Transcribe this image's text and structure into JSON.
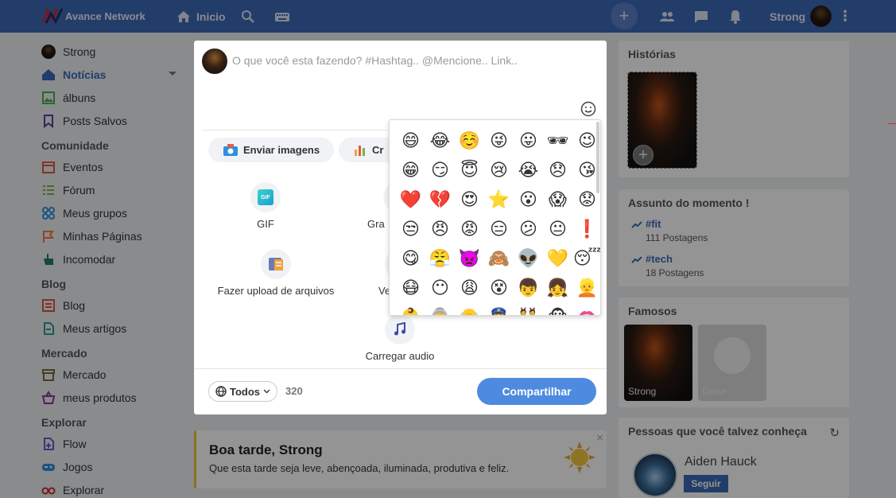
{
  "topbar": {
    "brand": "Avance Network",
    "home_label": "Inicio",
    "user_name": "Strong"
  },
  "sidebar": {
    "items": [
      {
        "label": "Strong"
      },
      {
        "label": "Notícias"
      },
      {
        "label": "álbuns"
      },
      {
        "label": "Posts Salvos"
      }
    ],
    "sections": [
      {
        "title": "Comunidade",
        "items": [
          "Eventos",
          "Fórum",
          "Meus grupos",
          "Minhas Páginas",
          "Incomodar"
        ]
      },
      {
        "title": "Blog",
        "items": [
          "Blog",
          "Meus artigos"
        ]
      },
      {
        "title": "Mercado",
        "items": [
          "Mercado",
          "meus produtos"
        ]
      },
      {
        "title": "Explorar",
        "items": [
          "Flow",
          "Jogos",
          "Explorar"
        ]
      }
    ]
  },
  "greeting": {
    "title": "Boa tarde, Strong",
    "subtitle": "Que esta tarde seja leve, abençoada, iluminada, produtiva e feliz.",
    "close": "×"
  },
  "right": {
    "stories_title": "Histórias",
    "trending_title": "Assunto do momento !",
    "trends": [
      {
        "tag": "#fit",
        "count": "111 Postagens"
      },
      {
        "tag": "#tech",
        "count": "18 Postagens"
      }
    ],
    "famous_title": "Famosos",
    "famous": [
      {
        "name": "Strong"
      },
      {
        "name": "Deise"
      }
    ],
    "people_title": "Pessoas que você talvez conheça",
    "person_name": "Aiden Hauck",
    "follow_label": "Seguir"
  },
  "composer": {
    "placeholder": "O que você esta fazendo? #Hashtag.. @Mencione.. Link..",
    "upload_images": "Enviar imagens",
    "create_partial": "Cr",
    "options": {
      "gif": "GIF",
      "gra_partial": "Gra",
      "upload_files": "Fazer upload de arquivos",
      "ve_partial": "Ve",
      "upload_audio": "Carregar audio"
    },
    "privacy": "Todos",
    "char_count": "320",
    "share": "Compartilhar"
  },
  "emoji_picker": {
    "emojis": [
      "😄",
      "😂",
      "☺️",
      "😜",
      "😛",
      "🕶",
      "😉",
      "😁",
      "😏",
      "😇",
      "😢",
      "😭",
      "😞",
      "😘",
      "❤️",
      "💔",
      "😍",
      "⭐",
      "😮",
      "😱",
      "😟",
      "😒",
      "😠",
      "😡",
      "😑",
      "😕",
      "😐",
      "❗",
      "😋",
      "😤",
      "👿",
      "🙈",
      "👽",
      "💛",
      "😴",
      "😷",
      "😶",
      "😩",
      "😵",
      "👦",
      "👧",
      "👱",
      "👶",
      "👵",
      "👴",
      "👮",
      "👯",
      "🐵",
      "👄"
    ]
  },
  "colors": {
    "topbar": "#3d69b7",
    "accent": "#3d69b7",
    "share_button": "#4e8be0",
    "greeting_border": "#f2c12e"
  }
}
